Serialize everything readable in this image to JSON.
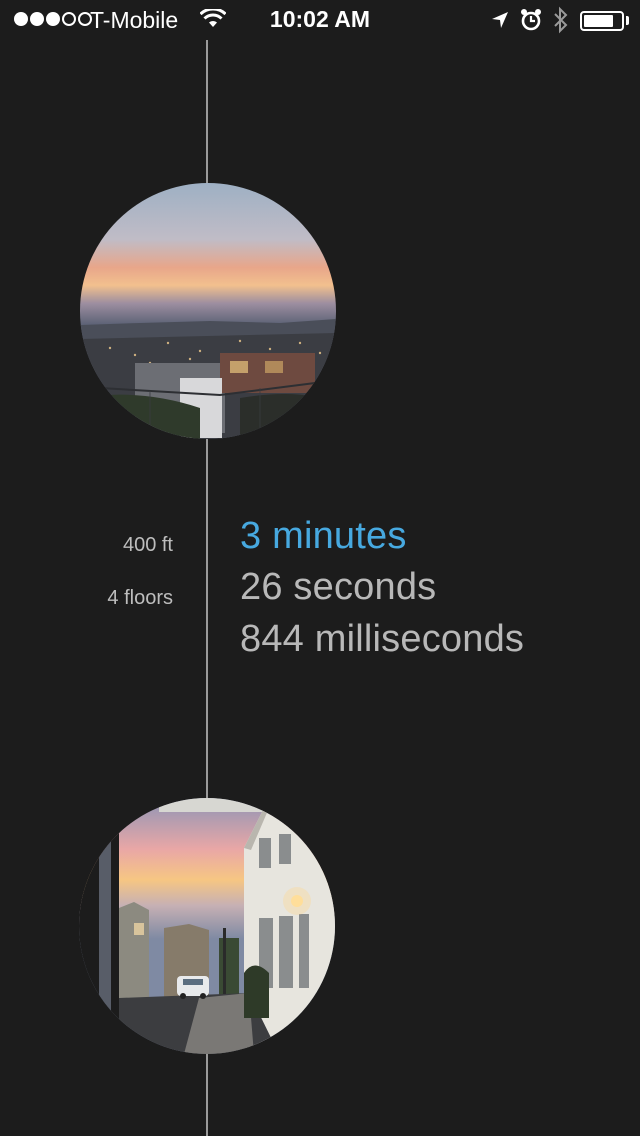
{
  "status_bar": {
    "carrier": "T-Mobile",
    "time": "10:02 AM",
    "signal_bars_filled": 3,
    "signal_bars_total": 5,
    "battery_level": 0.8,
    "icons": [
      "signal-dots-icon",
      "wifi-icon",
      "location-arrow-icon",
      "alarm-icon",
      "bluetooth-icon",
      "battery-icon"
    ]
  },
  "timeline": {
    "segment": {
      "distance": "400 ft",
      "floors": "4 floors",
      "duration_minutes": "3 minutes",
      "duration_seconds": "26 seconds",
      "duration_milliseconds": "844 milliseconds"
    },
    "photos": [
      {
        "subject": "sunset-city-view"
      },
      {
        "subject": "sunset-street-view"
      }
    ]
  },
  "colors": {
    "background": "#1c1c1c",
    "accent": "#47a9e0",
    "muted_text": "#b8b8b8",
    "timeline_line": "#9a9a9a"
  }
}
